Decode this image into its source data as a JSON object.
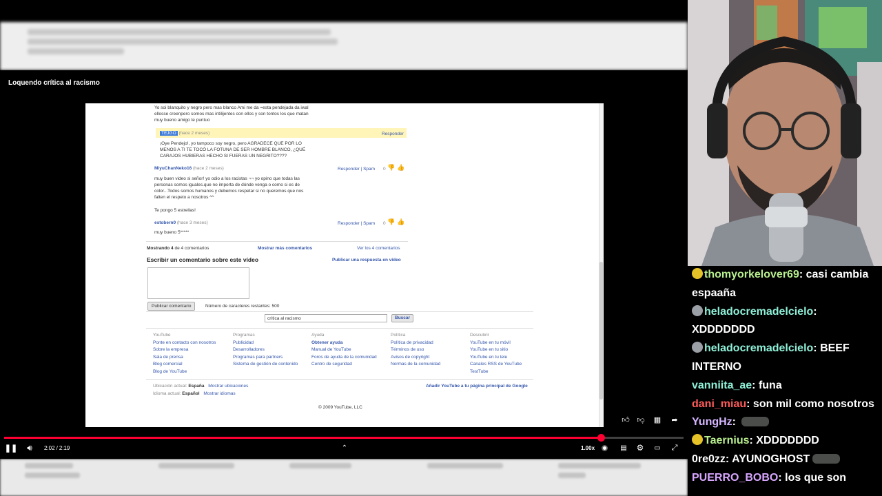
{
  "player": {
    "title": "Loquendo crítica al racismo",
    "current_time": "2:02",
    "separator": "/",
    "duration": "2:19",
    "progress": 0.878,
    "speed": "1.00x"
  },
  "page": {
    "comment_top": [
      "Yo soi blanquito y negro pero mas blanco Ami me da =esta pendejada da iwal",
      "ellosse creenpero somos mas intilijentes con ellos y son tontos los que matan",
      "muy bueno amigo te puntuo"
    ],
    "reply_user": "TEJGO",
    "reply_age": "(hace 2 meses)",
    "reply_action": "Responder",
    "reply_text": [
      "¡Oye Pendejo!, yo tampoco soy negro, pero AGRADECE QUE POR LO",
      "MENOS A TI TE TOCÓ LA FOTUNA DE SER HOMBRE BLANCO, ¿QUÉ",
      "CARAJOS HUBIERAS HECHO SI FUERAS UN NEGRITO????"
    ],
    "c2_user": "MiyuChanNeko16",
    "c2_age": "(hace 2 meses)",
    "c2_actions": "Responder | Spam",
    "c2_score": "0",
    "c2_text": [
      "muy buen video si señor! yo odio a los racistas ¬¬ yo opino que todas las",
      "personas somos iguales.que no importa de dónde venga o como si es de",
      "color...Todos somos humanos y debemos respetar si no queremos que nos",
      "falten el respeto a nosotros ^^"
    ],
    "c2_text_extra": "Te pongo 5 estrellas!",
    "c3_user": "estobern0",
    "c3_age": "(hace 3 meses)",
    "c3_actions": "Responder | Spam",
    "c3_score": "0",
    "c3_text": "muy bueno 5*****",
    "showing_label": "Mostrando 4",
    "showing_rest": "de 4 comentarios",
    "show_more": "Mostrar más comentarios",
    "see_all": "Ver los 4 comentarios",
    "write_heading": "Escribir un comentario sobre este vídeo",
    "video_reply": "Publicar una respuesta en vídeo",
    "publish_button": "Publicar comentario",
    "chars_left": "Número de caracteres restantes: 500",
    "search_value": "crítica al racismo",
    "search_button": "Buscar",
    "footer": [
      {
        "heading": "YouTube",
        "links": [
          "Ponte en contacto con nosotros",
          "Sobre la empresa",
          "Sala de prensa",
          "Blog comercial",
          "Blog de YouTube"
        ]
      },
      {
        "heading": "Programas",
        "links": [
          "Publicidad",
          "Desarrolladores",
          "Programas para partners",
          "Sistema de gestión de contenido"
        ]
      },
      {
        "heading": "Ayuda",
        "links": [
          "Obtener ayuda",
          "Manual de YouTube",
          "Foros de ayuda de la comunidad",
          "Centro de seguridad"
        ]
      },
      {
        "heading": "Política",
        "links": [
          "Política de privacidad",
          "Términos de uso",
          "Avisos de copyright",
          "Normas de la comunidad"
        ]
      },
      {
        "heading": "Descubrir",
        "links": [
          "YouTube en tu móvil",
          "YouTube en tu sitio",
          "YouTube en tu tele",
          "Canales RSS de YouTube",
          "TestTube"
        ]
      }
    ],
    "location_label": "Ubicación actual:",
    "location_value": "España",
    "location_link": "Mostrar ubicaciones",
    "language_label": "Idioma actual:",
    "language_value": "Español",
    "language_link": "Mostrar idiomas",
    "google_link": "Añadir YouTube a tu página principal de Google",
    "copyright": "© 2009 YouTube, LLC"
  },
  "chat": [
    {
      "user": "thomyorkelover69",
      "color": "#b9f08f",
      "badge": "#e6c229",
      "text": "casi cambia espaañа"
    },
    {
      "user": "heladocremadelcielo",
      "color": "#8ff0d8",
      "badge": "#9aa0a6",
      "text": "XDDDDDDD"
    },
    {
      "user": "heladocremadelcielo",
      "color": "#8ff0d8",
      "badge": "#9aa0a6",
      "text": "BEEF INTERNO"
    },
    {
      "user": "vanniita_ae",
      "color": "#8ff0d8",
      "badge": "",
      "text": "funa"
    },
    {
      "user": "dani_miau",
      "color": "#ff5a5a",
      "badge": "",
      "text": "son mil como nosotros"
    },
    {
      "user": "YungHz",
      "color": "#d6b6ff",
      "badge": "",
      "text": ""
    },
    {
      "user": "Taernius",
      "color": "#b9f08f",
      "badge": "#e6c229",
      "text": "XDDDDDDD"
    },
    {
      "user": "0re0zz",
      "color": "#ffffff",
      "badge": "",
      "text": "AYUNOGHOST"
    },
    {
      "user": "PUERRO_BOBO",
      "color": "#d8a6ff",
      "badge": "",
      "text": "los que son"
    }
  ]
}
